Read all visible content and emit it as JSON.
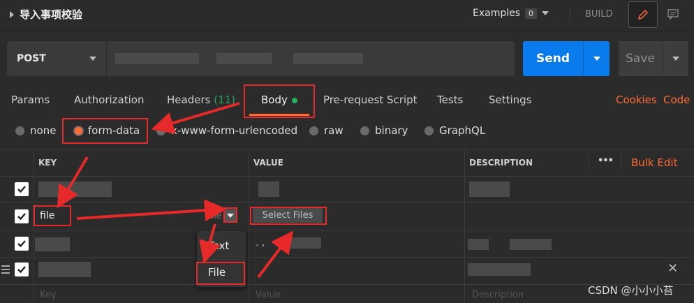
{
  "header": {
    "collection_title": "导入事项校验",
    "examples_label": "Examples",
    "examples_count": "0",
    "build_label": "BUILD"
  },
  "request": {
    "method": "POST",
    "url_value": "",
    "send_label": "Send",
    "save_label": "Save"
  },
  "tabs": [
    {
      "label": "Params"
    },
    {
      "label": "Authorization"
    },
    {
      "label": "Headers",
      "count": "(11)"
    },
    {
      "label": "Body"
    },
    {
      "label": "Pre-request Script"
    },
    {
      "label": "Tests"
    },
    {
      "label": "Settings"
    }
  ],
  "links": {
    "cookies": "Cookies",
    "code": "Code"
  },
  "body_types": [
    "none",
    "form-data",
    "x-www-form-urlencoded",
    "raw",
    "binary",
    "GraphQL"
  ],
  "body_type_selected": "form-data",
  "table": {
    "headers": {
      "key": "KEY",
      "value": "VALUE",
      "description": "DESCRIPTION"
    },
    "more_label": "•••",
    "bulk_edit": "Bulk Edit",
    "rows": [
      {
        "key": "",
        "type": "",
        "value": "",
        "description": ""
      },
      {
        "key": "file",
        "type": "File",
        "value_button": "Select Files",
        "description": ""
      },
      {
        "key": "",
        "type": "",
        "value": ". ,",
        "description": ""
      },
      {
        "key": "",
        "type": "",
        "value": "",
        "description": ""
      }
    ],
    "placeholders": {
      "key": "Key",
      "value": "Value",
      "description": "Description"
    }
  },
  "type_dropdown": {
    "options": [
      "Text",
      "File"
    ]
  },
  "watermark": "CSDN @小小小苔",
  "colors": {
    "accent": "#ff6c37",
    "send_blue": "#097bed",
    "annotation_red": "#e62a2a",
    "green": "#27ae60"
  }
}
